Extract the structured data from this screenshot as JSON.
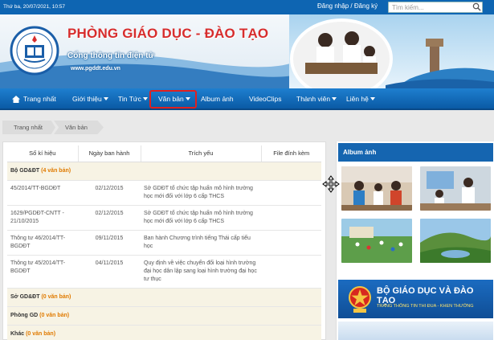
{
  "topbar": {
    "date": "Thứ ba, 20/07/2021, 10:57",
    "login": "Đăng nhập / Đăng ký",
    "search_placeholder": "Tìm kiếm..."
  },
  "banner": {
    "title": "PHÒNG GIÁO DỤC - ĐÀO TẠO",
    "subtitle": "Cổng thông tin điện tử",
    "site": "www.pgddt.edu.vn"
  },
  "nav": {
    "items": [
      {
        "label": "Trang nhất",
        "has_menu": false
      },
      {
        "label": "Giới thiệu",
        "has_menu": true
      },
      {
        "label": "Tin Tức",
        "has_menu": true
      },
      {
        "label": "Văn bản",
        "has_menu": true,
        "active": true
      },
      {
        "label": "Album ảnh",
        "has_menu": false
      },
      {
        "label": "VideoClips",
        "has_menu": false
      },
      {
        "label": "Thành viên",
        "has_menu": true
      },
      {
        "label": "Liên hệ",
        "has_menu": true
      }
    ]
  },
  "breadcrumb": [
    "Trang nhất",
    "Văn bản"
  ],
  "table": {
    "headers": [
      "Số kí hiệu",
      "Ngày ban hành",
      "Trích yếu",
      "File đính kèm"
    ],
    "groups": [
      {
        "name": "Bộ GD&ĐT",
        "count": "(4 văn bản)",
        "rows": [
          {
            "code": "45/2014/TT-BGDĐT",
            "date": "02/12/2015",
            "summary": "Sở GDĐT tổ chức tập huấn mô hình trường học mới đối với lớp 6 cấp THCS"
          },
          {
            "code": "1629/PGDĐT-CNTT - 21/10/2015",
            "date": "02/12/2015",
            "summary": "Sở GDĐT tổ chức tập huấn mô hình trường học mới đối với lớp 6 cấp THCS"
          },
          {
            "code": "Thông tư 46/2014/TT-BGDĐT",
            "date": "09/11/2015",
            "summary": "Ban hành Chương trình tiếng Thái cấp tiểu học"
          },
          {
            "code": "Thông tư 45/2014/TT-BGDĐT",
            "date": "04/11/2015",
            "summary": "Quy định về việc chuyển đổi loại hình trường đại học dân lập sang loại hình trường đại học tư thục"
          }
        ]
      },
      {
        "name": "Sở GD&ĐT",
        "count": "(0 văn bản)",
        "rows": []
      },
      {
        "name": "Phòng GD",
        "count": "(0 văn bản)",
        "rows": []
      },
      {
        "name": "Khác",
        "count": "(0 văn bản)",
        "rows": []
      }
    ]
  },
  "sidebar": {
    "album_title": "Album ảnh",
    "ad_title": "BỘ GIÁO DỤC VÀ ĐÀO TẠO",
    "ad_subtitle": "TRANG THÔNG TIN THI ĐUA - KHEN THƯỞNG"
  },
  "colors": {
    "primary": "#0e65b2",
    "title_red": "#d72d2d",
    "count_orange": "#e07a00",
    "active_outline": "#e02020"
  }
}
